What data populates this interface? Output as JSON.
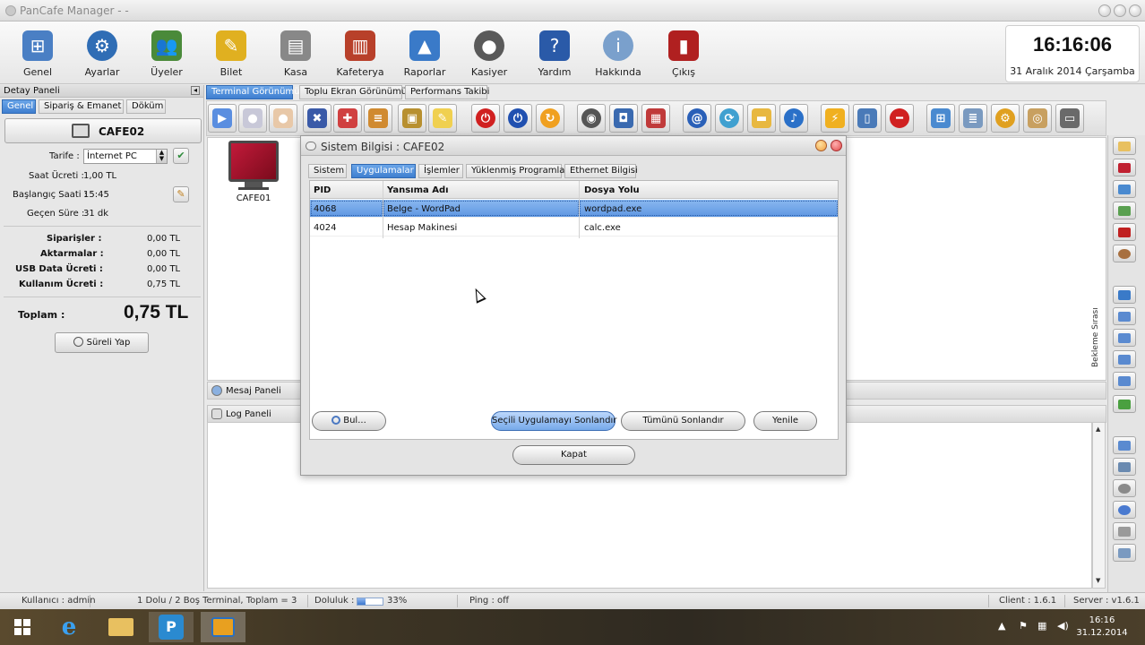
{
  "window": {
    "title": "PanCafe Manager - -"
  },
  "main_toolbar": {
    "items": [
      {
        "label": "Genel",
        "icon": "network-pc-icon",
        "color": "#4a7fc4"
      },
      {
        "label": "Ayarlar",
        "icon": "gear-icon",
        "color": "#2f6db5"
      },
      {
        "label": "Üyeler",
        "icon": "users-icon",
        "color": "#4a8a3a"
      },
      {
        "label": "Bilet",
        "icon": "ticket-icon",
        "color": "#e0b020"
      },
      {
        "label": "Kasa",
        "icon": "cash-register-icon",
        "color": "#888888"
      },
      {
        "label": "Kafeterya",
        "icon": "shop-icon",
        "color": "#b8402a"
      },
      {
        "label": "Raporlar",
        "icon": "chart-icon",
        "color": "#3a7ac8"
      },
      {
        "label": "Kasiyer",
        "icon": "person-icon",
        "color": "#5a5a5a"
      },
      {
        "label": "Yardım",
        "icon": "help-book-icon",
        "color": "#2a5aa8"
      },
      {
        "label": "Hakkında",
        "icon": "info-icon",
        "color": "#7aa0cc"
      },
      {
        "label": "Çıkış",
        "icon": "exit-door-icon",
        "color": "#b02020"
      }
    ]
  },
  "clock": {
    "time": "16:16:06",
    "date": "31 Aralık 2014 Çarşamba"
  },
  "detail_panel": {
    "title": "Detay Paneli",
    "tabs": [
      "Genel",
      "Sipariş & Emanet",
      "Döküm"
    ],
    "active_tab": 0,
    "terminal_name": "CAFE02",
    "tariff_label": "Tarife :",
    "tariff_value": "İnternet PC",
    "hourly_label": "Saat Ücreti :",
    "hourly_value": "1,00 TL",
    "start_label": "Başlangıç Saati :",
    "start_value": "15:45",
    "elapsed_label": "Geçen Süre :",
    "elapsed_value": "31 dk",
    "fees": [
      {
        "label": "Siparişler :",
        "value": "0,00 TL"
      },
      {
        "label": "Aktarmalar :",
        "value": "0,00 TL"
      },
      {
        "label": "USB Data Ücreti :",
        "value": "0,00 TL"
      },
      {
        "label": "Kullanım Ücreti :",
        "value": "0,75 TL"
      }
    ],
    "total_label": "Toplam :",
    "total_value": "0,75 TL",
    "timed_button": "Süreli Yap"
  },
  "center_tabs": [
    "Terminal Görünümü",
    "Toplu Ekran Görünümü",
    "Performans Takibi"
  ],
  "terminal": {
    "name": "CAFE01"
  },
  "message_panel": "Mesaj Paneli",
  "log_panel": "Log Paneli",
  "waiting_queue": "Bekleme Sırası",
  "dialog": {
    "title": "Sistem Bilgisi : CAFE02",
    "tabs": [
      "Sistem",
      "Uygulamalar",
      "İşlemler",
      "Yüklenmiş Programlar",
      "Ethernet Bilgisi"
    ],
    "active_tab": 1,
    "columns": [
      "PID",
      "Yansıma Adı",
      "Dosya Yolu"
    ],
    "rows": [
      {
        "pid": "4068",
        "name": "Belge - WordPad",
        "path": "wordpad.exe",
        "selected": true
      },
      {
        "pid": "4024",
        "name": "Hesap Makinesi",
        "path": "calc.exe",
        "selected": false
      }
    ],
    "find_button": "Bul...",
    "end_selected_button": "Seçili Uygulamayı Sonlandır",
    "end_all_button": "Tümünü Sonlandır",
    "refresh_button": "Yenile",
    "close_button": "Kapat"
  },
  "status_bar": {
    "user": "Kullanıcı : admin",
    "terminals": "1 Dolu / 2 Boş Terminal, Toplam = 3",
    "fill_label": "Doluluk :",
    "fill_percent": 33,
    "fill_text": "33%",
    "ping": "Ping : off",
    "client": "Client : 1.6.1",
    "server": "Server : v1.6.1"
  },
  "taskbar": {
    "time": "16:16",
    "date": "31.12.2014"
  }
}
